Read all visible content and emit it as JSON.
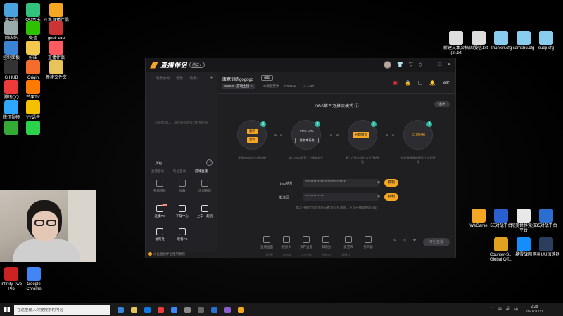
{
  "desktop": {
    "left_icons": [
      {
        "label": "此电脑",
        "color": "#4aa3df"
      },
      {
        "label": "QQ音乐",
        "color": "#31c27c"
      },
      {
        "label": "斗鱼直播伴侣",
        "color": "#f5a623"
      },
      {
        "label": "回收站",
        "color": "#9aa"
      },
      {
        "label": "微信",
        "color": "#2dc100"
      },
      {
        "label": "geek.exe",
        "color": "#c33"
      },
      {
        "label": "控制面板",
        "color": "#3b83d6"
      },
      {
        "label": "好压",
        "color": "#f2c94c"
      },
      {
        "label": "直播伴侣",
        "color": "#ff5a5f"
      },
      {
        "label": "G HUB",
        "color": "#333"
      },
      {
        "label": "Origin",
        "color": "#f56c2d"
      },
      {
        "label": "新建文件夹",
        "color": "#e8c25a"
      },
      {
        "label": "腾讯QQ",
        "color": "#ee3a3a"
      },
      {
        "label": "芒果TV",
        "color": "#ff7a00"
      },
      {
        "label": "",
        "color": ""
      },
      {
        "label": "腾讯视频",
        "color": "#2fa7ff"
      },
      {
        "label": "YY语音",
        "color": "#f5c000"
      },
      {
        "label": "",
        "color": ""
      },
      {
        "label": "",
        "color": "#3a3"
      },
      {
        "label": "",
        "color": "#2bd24c"
      }
    ],
    "bottom_left_icons": [
      {
        "label": "Infinity Two Pro",
        "color": "#c22"
      },
      {
        "label": "Google Chrome",
        "color": "#4285f4"
      }
    ],
    "right_top_icons": [
      {
        "label": "新建文本文档 (2).txt",
        "color": "#ddd"
      },
      {
        "label": "国服信.txt",
        "color": "#ddd"
      },
      {
        "label": "zhunxin.cfg",
        "color": "#8ce"
      },
      {
        "label": "camshu.cfg",
        "color": "#8ce"
      },
      {
        "label": "sueji.cfg",
        "color": "#8ce"
      }
    ],
    "right_mid_icons": [
      {
        "label": "WeGame",
        "color": "#f5a623"
      },
      {
        "label": "5E对战平台",
        "color": "#2a5fd0"
      },
      {
        "label": "完美世界竞技平台",
        "color": "#e8e8e8"
      },
      {
        "label": "B5对战平台",
        "color": "#2a6ed0"
      },
      {
        "label": "Counter-S... Global Off...",
        "color": "#e0a020"
      },
      {
        "label": "暴雪战网",
        "color": "#148eff"
      },
      {
        "label": "网易UU加速器",
        "color": "#2c3e5d"
      }
    ]
  },
  "app": {
    "name": "直播伴侣",
    "version_badge": "测试 ▸",
    "titlebar_icons": [
      "avatar",
      "shirt-icon",
      "filter-icon",
      "tag-icon",
      "minimize-icon",
      "maximize-icon",
      "close-icon"
    ],
    "scene_tabs": [
      "场景编辑",
      "场景",
      "场景2"
    ],
    "scene_add": "+",
    "empty_hint": "可添加窗口、游戏画面等作为直播内容",
    "toolbox_title": "工具箱",
    "toolbox_more": "⋯",
    "toolbox_tabs": [
      "直播互动",
      "粉丝互动",
      "游戏直播"
    ],
    "tools_row1": [
      {
        "label": "礼物特效"
      },
      {
        "label": "弹幕"
      },
      {
        "label": "房间管理"
      }
    ],
    "tools_row2": [
      {
        "label": "连麦PK",
        "badge": "HOT"
      },
      {
        "label": "下载中心"
      },
      {
        "label": "上车一起玩"
      }
    ],
    "tools_row3": [
      {
        "label": "福利社"
      },
      {
        "label": "观看PK"
      }
    ],
    "footnote": "斗鱼直播伴侣使用教程",
    "room_title": "康默训练gogogo",
    "edit_label": "编辑",
    "category": "CSGO · 游戏主播 ✎",
    "stats": [
      "本周领奖中",
      "9764311",
      "♨ 1427"
    ],
    "header_icons": [
      "live-icon",
      "lock-icon",
      "box-icon",
      "bell-icon",
      "share-icon"
    ],
    "mode_title": "OBS第三方推流模式 ⓘ",
    "exit_label": "退出",
    "steps": [
      {
        "num": "1",
        "buttons": [
          "复制",
          "复制"
        ],
        "desc": "复制rtmp地址与推流码"
      },
      {
        "num": "2",
        "top": "FMS URL",
        "bottom": "推流/串码流",
        "desc": "填入OBS等第三方推流软件"
      },
      {
        "num": "3",
        "button": "开始推流",
        "desc": "第三方推流软件 点击开始推流"
      },
      {
        "num": "4",
        "top": "自动开播",
        "desc": "伴侣确保推送画面后 自动开播"
      }
    ],
    "rtmp_label": "rtmp地址",
    "rtmp_value": "******************************",
    "key_label": "推流码",
    "key_value": "**************",
    "copy_label": "复制",
    "note": "本次开播RTMP地址与推流码有效期，下次开播需重新获取",
    "bottom_tools": [
      "直播画面",
      "视频头",
      "多开直播",
      "多路画",
      "麦克风",
      "扬声器"
    ],
    "go_live": "开始直播",
    "status_items": [
      "比特率",
      "FPS 0",
      "CPU 0%",
      "内存 0%",
      "丢帧 0"
    ]
  },
  "taskbar": {
    "search_placeholder": "在这里输入你要搜索的内容",
    "time": "2:28",
    "date": "2021/10/21",
    "ime": "中",
    "app_colors": [
      "#3b83d6",
      "#e8c25a",
      "#0f7ae5",
      "#ee3a3a",
      "#4285f4",
      "#888",
      "#666",
      "#2a6ed0",
      "#8a5cd0",
      "#f5a623"
    ]
  }
}
